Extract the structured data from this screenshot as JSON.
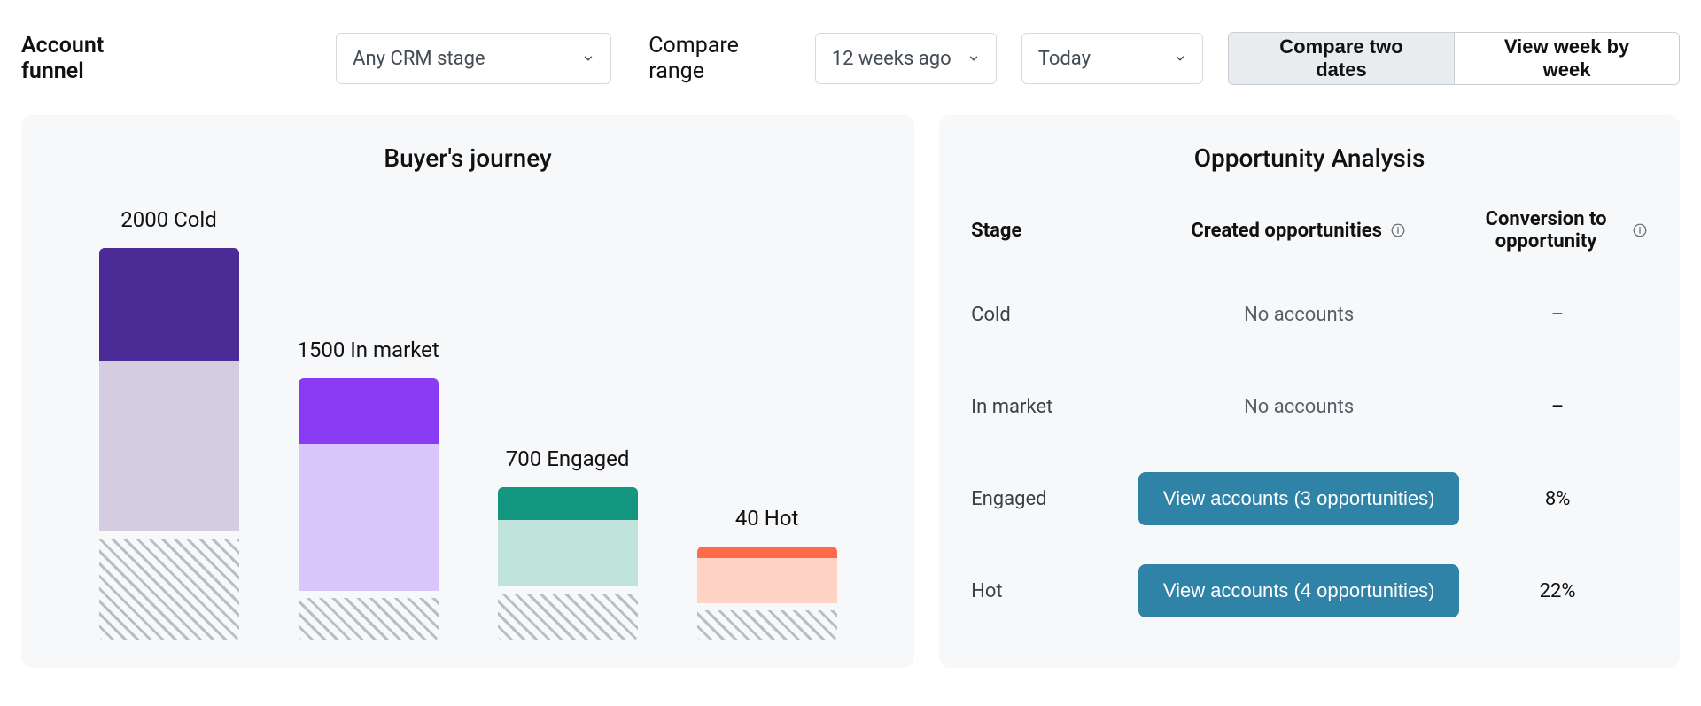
{
  "header": {
    "title": "Account funnel",
    "crm_stage": "Any CRM stage",
    "compare_label": "Compare range",
    "range_start": "12 weeks ago",
    "range_end": "Today",
    "toggle_compare": "Compare two dates",
    "toggle_weekly": "View week by week"
  },
  "journey": {
    "title": "Buyer's journey"
  },
  "chart_data": {
    "type": "bar",
    "title": "Buyer's journey",
    "xlabel": "",
    "ylabel": "",
    "ylim": [
      0,
      2000
    ],
    "categories": [
      "Cold",
      "In market",
      "Engaged",
      "Hot"
    ],
    "series": [
      {
        "name": "current_top",
        "values": [
          800,
          460,
          230,
          80
        ],
        "colors": [
          "#4b2b96",
          "#8a3cf5",
          "#12967f",
          "#ff6b4a"
        ]
      },
      {
        "name": "current_bottom",
        "values": [
          1200,
          1040,
          470,
          320
        ],
        "colors": [
          "#d4cddf",
          "#d9c6fa",
          "#bfe3db",
          "#ffd3c6"
        ]
      },
      {
        "name": "lost_hatched",
        "values": [
          720,
          300,
          330,
          210
        ]
      }
    ],
    "counts": [
      2000,
      1500,
      700,
      40
    ],
    "bar_labels": [
      "2000 Cold",
      "1500 In market",
      "700 Engaged",
      "40 Hot"
    ]
  },
  "opportunity": {
    "title": "Opportunity Analysis",
    "columns": {
      "stage": "Stage",
      "created": "Created opportunities",
      "conversion": "Conversion to opportunity"
    },
    "rows": [
      {
        "stage": "Cold",
        "created_text": "No accounts",
        "conversion": "–",
        "button": null
      },
      {
        "stage": "In market",
        "created_text": "No accounts",
        "conversion": "–",
        "button": null
      },
      {
        "stage": "Engaged",
        "created_text": null,
        "conversion": "8%",
        "button": "View accounts (3 opportunities)"
      },
      {
        "stage": "Hot",
        "created_text": null,
        "conversion": "22%",
        "button": "View accounts (4 opportunities)"
      }
    ]
  }
}
